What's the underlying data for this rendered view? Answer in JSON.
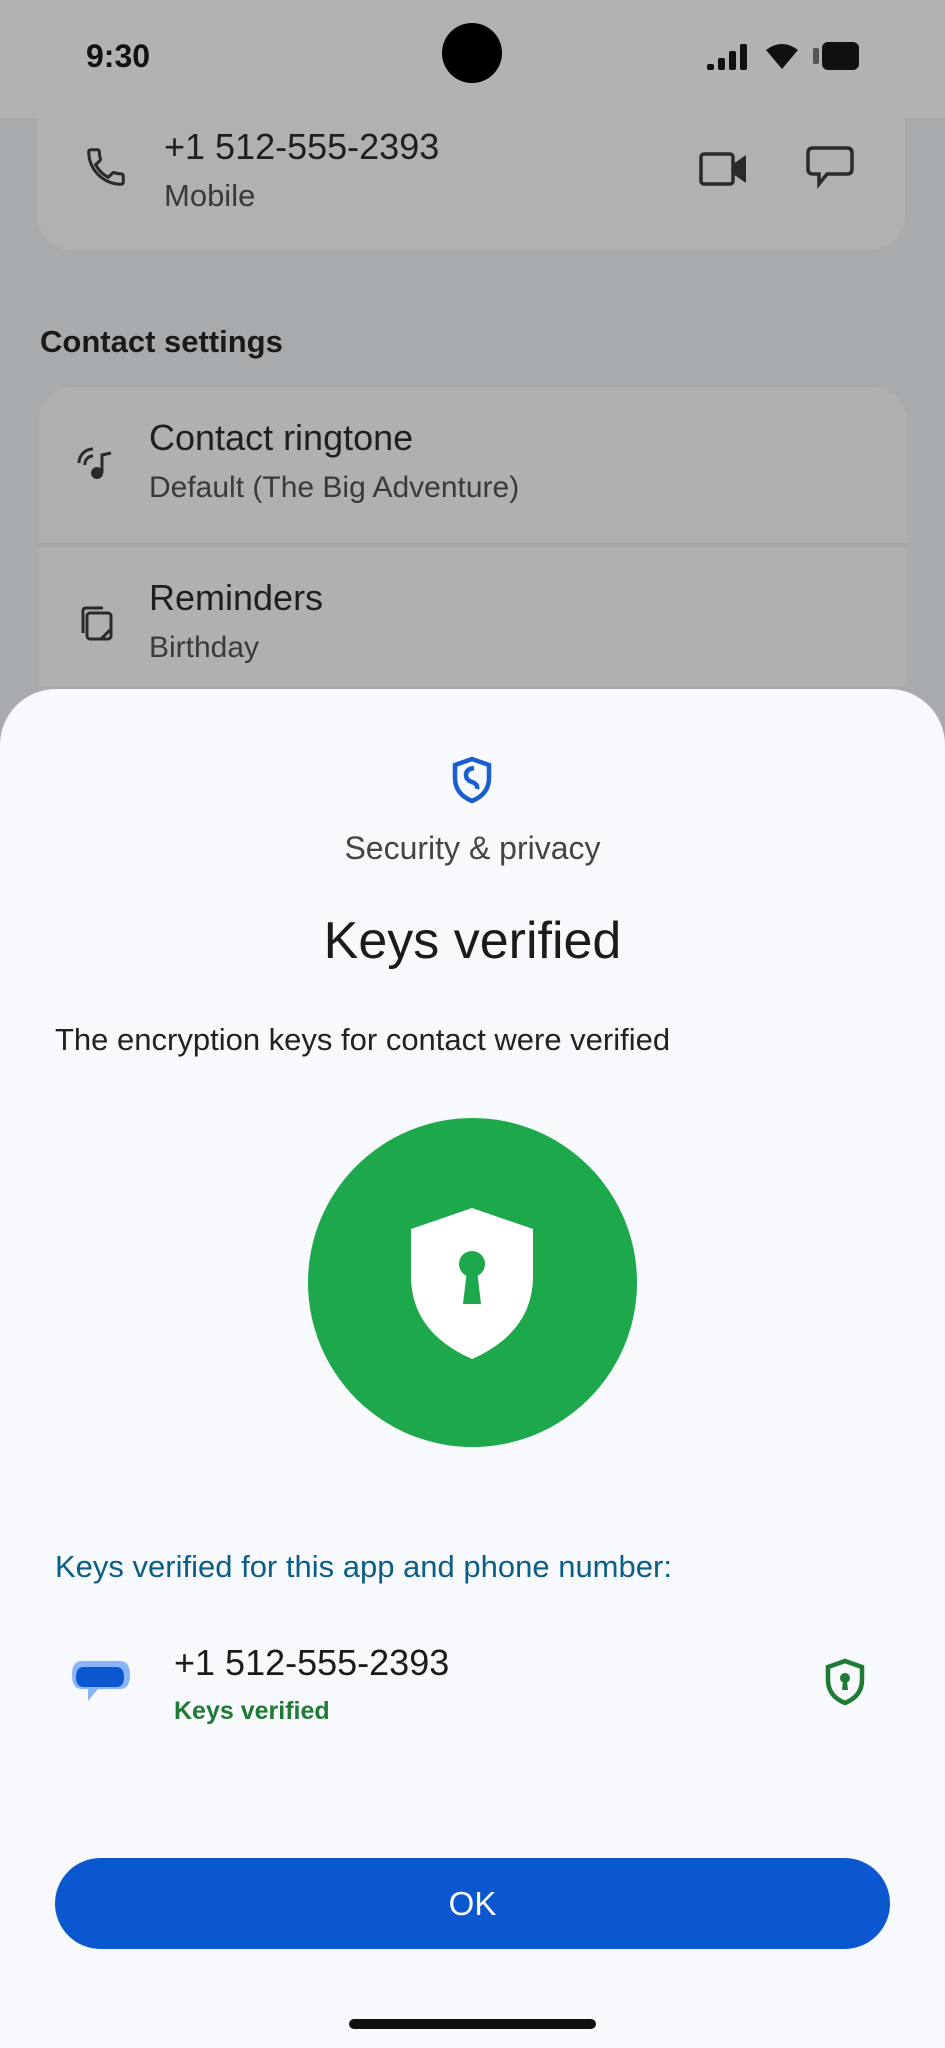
{
  "status_bar": {
    "time": "9:30"
  },
  "contact": {
    "phone_number": "+1 512-555-2393",
    "phone_type": "Mobile"
  },
  "contact_settings": {
    "title": "Contact settings",
    "items": [
      {
        "label": "Contact ringtone",
        "value": "Default (The Big Adventure)",
        "icon": "ringtone-icon"
      },
      {
        "label": "Reminders",
        "value": "Birthday",
        "icon": "reminders-icon"
      }
    ]
  },
  "sheet": {
    "subtitle": "Security & privacy",
    "title": "Keys verified",
    "description": "The encryption keys for contact were verified",
    "keys_heading": "Keys verified for this app and phone number:",
    "entry": {
      "number": "+1 512-555-2393",
      "status": "Keys verified"
    },
    "ok_label": "OK"
  },
  "colors": {
    "accent": "#0b57d0",
    "verified_green": "#1ea84c",
    "status_green": "#1f7a34",
    "heading_blue": "#0b5e86"
  }
}
